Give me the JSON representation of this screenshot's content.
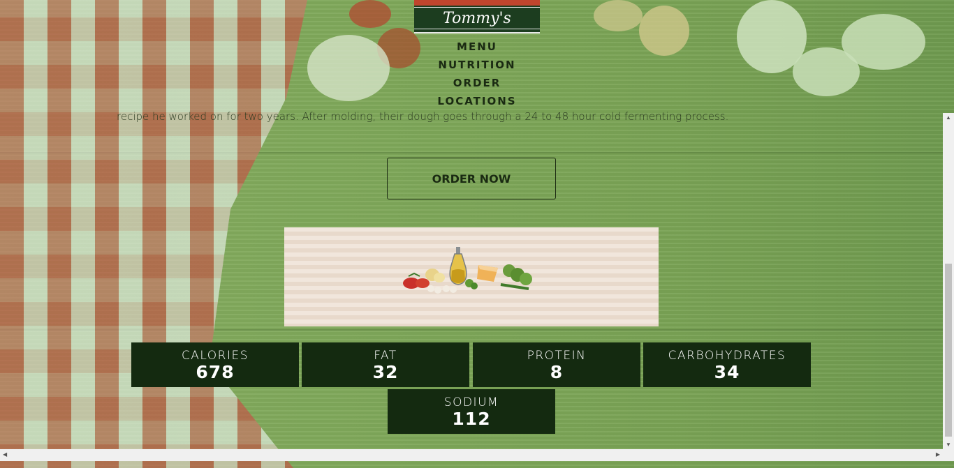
{
  "brand": {
    "name": "Tommy's"
  },
  "nav": {
    "items": [
      "MENU",
      "NUTRITION",
      "ORDER",
      "LOCATIONS"
    ]
  },
  "intro": {
    "text": "recipe he worked on for two years. After molding, their dough goes through a 24 to 48 hour cold fermenting process."
  },
  "cta": {
    "label": "ORDER NOW"
  },
  "nutrition": [
    {
      "label": "CALORIES",
      "value": "678"
    },
    {
      "label": "FAT",
      "value": "32"
    },
    {
      "label": "PROTEIN",
      "value": "8"
    },
    {
      "label": "CARBOHYDRATES",
      "value": "34"
    },
    {
      "label": "SODIUM",
      "value": "112"
    }
  ],
  "colors": {
    "stat_bg": "#142a10",
    "logo_green": "#1c3d1f",
    "wood_green": "#7ea55a"
  }
}
